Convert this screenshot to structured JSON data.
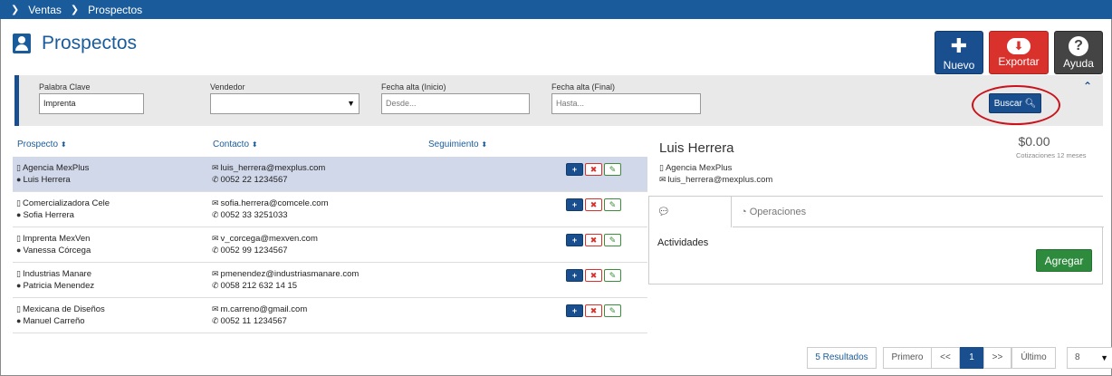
{
  "breadcrumb": {
    "items": [
      "Ventas",
      "Prospectos"
    ]
  },
  "page": {
    "title": "Prospectos"
  },
  "actions": {
    "nuevo": "Nuevo",
    "exportar": "Exportar",
    "ayuda": "Ayuda"
  },
  "filters": {
    "keyword_label": "Palabra Clave",
    "keyword_value": "Imprenta",
    "vendor_label": "Vendedor",
    "vendor_value": "",
    "start_label": "Fecha alta (Inicio)",
    "start_placeholder": "Desde...",
    "end_label": "Fecha alta (Final)",
    "end_placeholder": "Hasta...",
    "search_label": "Buscar"
  },
  "table": {
    "headers": {
      "prospecto": "Prospecto",
      "contacto": "Contacto",
      "seguimiento": "Seguimiento"
    },
    "rows": [
      {
        "company": "Agencia MexPlus",
        "person": "Luis Herrera",
        "email": "luis_herrera@mexplus.com",
        "phone": "0052 22 1234567"
      },
      {
        "company": "Comercializadora Cele",
        "person": "Sofia Herrera",
        "email": "sofia.herrera@comcele.com",
        "phone": "0052 33 3251033"
      },
      {
        "company": "Imprenta MexVen",
        "person": "Vanessa Córcega",
        "email": "v_corcega@mexven.com",
        "phone": "0052 99 1234567"
      },
      {
        "company": "Industrias Manare",
        "person": "Patricia Menendez",
        "email": "pmenendez@industriasmanare.com",
        "phone": "0058 212 632 14 15"
      },
      {
        "company": "Mexicana de Diseños",
        "person": "Manuel Carreño",
        "email": "m.carreno@gmail.com",
        "phone": "0052 11 1234567"
      }
    ]
  },
  "detail": {
    "name": "Luis Herrera",
    "company": "Agencia MexPlus",
    "email": "luis_herrera@mexplus.com",
    "amount": "$0.00",
    "amount_caption": "Cotizaciones 12 meses",
    "tabs": [
      "Actividades",
      "Operaciones"
    ],
    "add_label": "Agregar"
  },
  "pagination": {
    "results": "5 Resultados",
    "first": "Primero",
    "prev": "<<",
    "current": "1",
    "next": ">>",
    "last": "Último",
    "page_size": "8"
  },
  "colors": {
    "primary": "#1a4f8f",
    "danger": "#d9322c",
    "success": "#2e8b3e",
    "dark": "#444444",
    "selected_row": "#d1d8ea"
  }
}
